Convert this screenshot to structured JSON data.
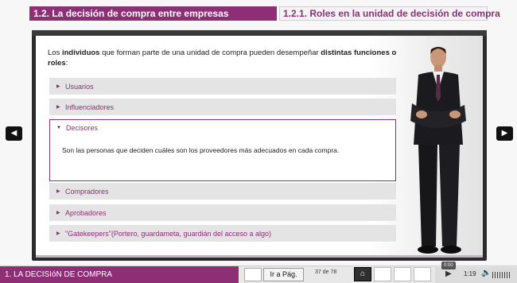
{
  "header": {
    "section": "1.2. La decisión de compra entre empresas",
    "subsection": "1.2.1. Roles en la unidad de decisión de compra"
  },
  "intro": {
    "p1": "Los ",
    "b1": "individuos",
    "p2": " que forman parte de una unidad de compra pueden desempeñar ",
    "b2": "distintas funciones o roles",
    "p3": ":"
  },
  "accordion": {
    "usuarios": "Usuarios",
    "influenciadores": "Influenciadores",
    "decisores": "Decisores",
    "decisores_body": "Son las personas que deciden cuáles son los proveedores más adecuados en cada compra.",
    "compradores": "Compradores",
    "aprobadores": "Aprobadores",
    "gatekeepers": "\"Gatekeepers\"(Portero, guardameta, guardián del acceso a algo)"
  },
  "footer": {
    "course_title": "1. LA DECISIóN DE COMPRA",
    "page_input_value": "",
    "goto_label": "Ir a Pág.",
    "page_count": "37 de 78",
    "media_time": "1:19",
    "media_tooltip": "0:00"
  },
  "icons": {
    "prev": "chevron-left-icon",
    "next": "chevron-right-icon",
    "home": "home-icon",
    "play": "play-icon",
    "volume": "volume-icon"
  },
  "colors": {
    "accent": "#8e2f76",
    "frame": "#2b2b2b",
    "accordion_bg": "#e4e4e4"
  }
}
